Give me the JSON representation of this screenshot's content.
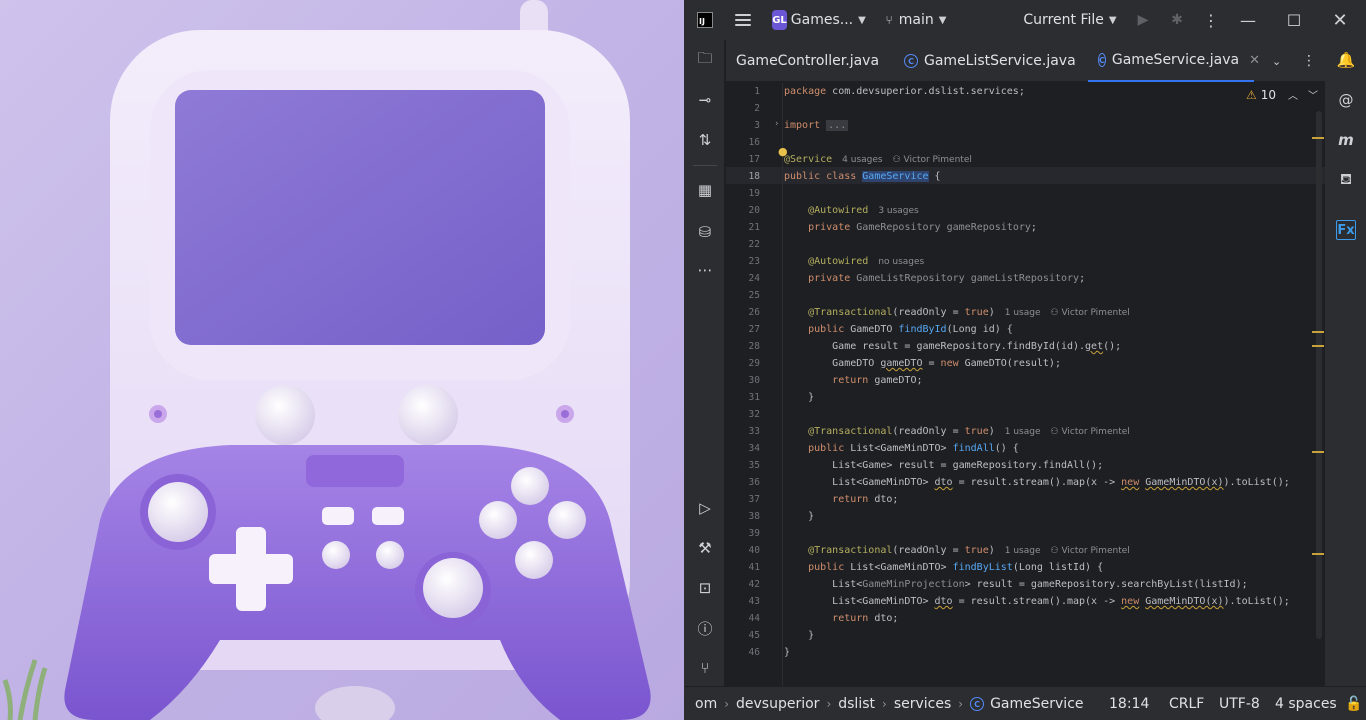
{
  "titlebar": {
    "project_badge": "GL",
    "project_name": "Games...",
    "branch": "main",
    "run_config": "Current File",
    "menu_icon": "hamburger-icon"
  },
  "tabs": [
    {
      "label": "GameController.java",
      "active": false
    },
    {
      "label": "GameListService.java",
      "active": false
    },
    {
      "label": "GameService.java",
      "active": true
    }
  ],
  "editor": {
    "warnings_count": "10",
    "line_numbers": [
      "1",
      "2",
      "3",
      "16",
      "17",
      "18",
      "19",
      "20",
      "21",
      "22",
      "23",
      "24",
      "25",
      "26",
      "27",
      "28",
      "29",
      "30",
      "31",
      "32",
      "33",
      "34",
      "35",
      "36",
      "37",
      "38",
      "39",
      "40",
      "41",
      "42",
      "43",
      "44",
      "45",
      "46"
    ],
    "hints": {
      "service_usages": "4 usages",
      "author": "Victor Pimentel",
      "game_repo_usages": "3 usages",
      "game_list_repo_usages": "no usages",
      "find_by_id_usages": "1 usage",
      "find_all_usages": "1 usage",
      "find_by_list_usages": "1 usage"
    }
  },
  "statusbar": {
    "breadcrumbs": [
      "om",
      "devsuperior",
      "dslist",
      "services",
      "GameService"
    ],
    "position": "18:14",
    "line_ending": "CRLF",
    "encoding": "UTF-8",
    "indent": "4 spaces"
  },
  "colors": {
    "accent": "#3574f0",
    "keyword": "#cf8e6d",
    "annotation": "#b3ae60",
    "warning": "#c9a23b",
    "art_purple": "#8f6fd6"
  }
}
